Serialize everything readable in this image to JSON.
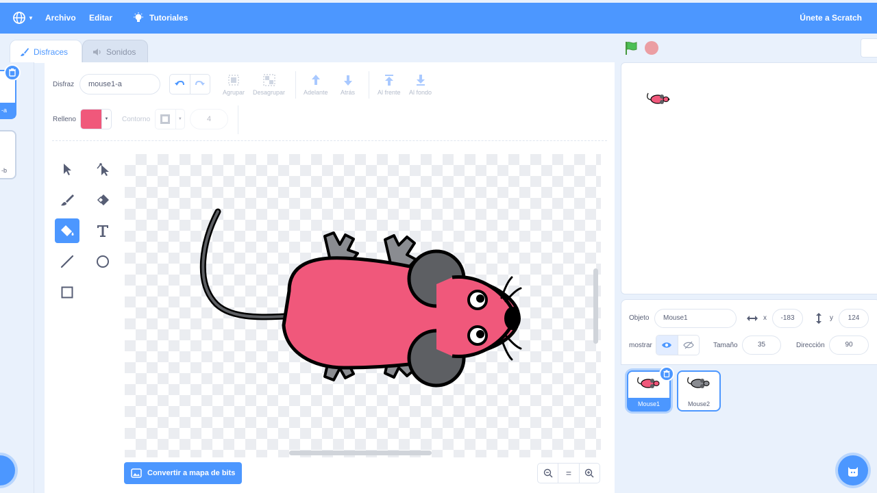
{
  "menu": {
    "file": "Archivo",
    "edit": "Editar",
    "tutorials": "Tutoriales",
    "join": "Únete a Scratch"
  },
  "tabs": {
    "costumes": "Disfraces",
    "sounds": "Sonidos"
  },
  "costume_list": [
    {
      "label": "-a",
      "selected": true
    },
    {
      "label": "-b",
      "selected": false
    }
  ],
  "paint": {
    "costume_label": "Disfraz",
    "costume_name": "mouse1-a",
    "group": "Agrupar",
    "ungroup": "Desagrupar",
    "forward": "Adelante",
    "backward": "Atrás",
    "front": "Al frente",
    "back": "Al fondo",
    "fill_label": "Relleno",
    "outline_label": "Contorno",
    "outline_size": "4",
    "fill_color": "#f0587b",
    "convert_bitmap": "Convertir a mapa de bits",
    "zoom_reset": "="
  },
  "sprite": {
    "object_label": "Objeto",
    "name": "Mouse1",
    "x_label": "x",
    "x": "-183",
    "y_label": "y",
    "y": "124",
    "show_label": "mostrar",
    "size_label": "Tamaño",
    "size": "35",
    "direction_label": "Dirección",
    "direction": "90"
  },
  "sprites": [
    {
      "name": "Mouse1",
      "selected": true
    },
    {
      "name": "Mouse2",
      "selected": false
    }
  ],
  "colors": {
    "accent": "#4c97ff",
    "mouse_body": "#f0587b",
    "mouse_ears": "#5d5f63",
    "mouse_feet": "#8a8c91"
  }
}
